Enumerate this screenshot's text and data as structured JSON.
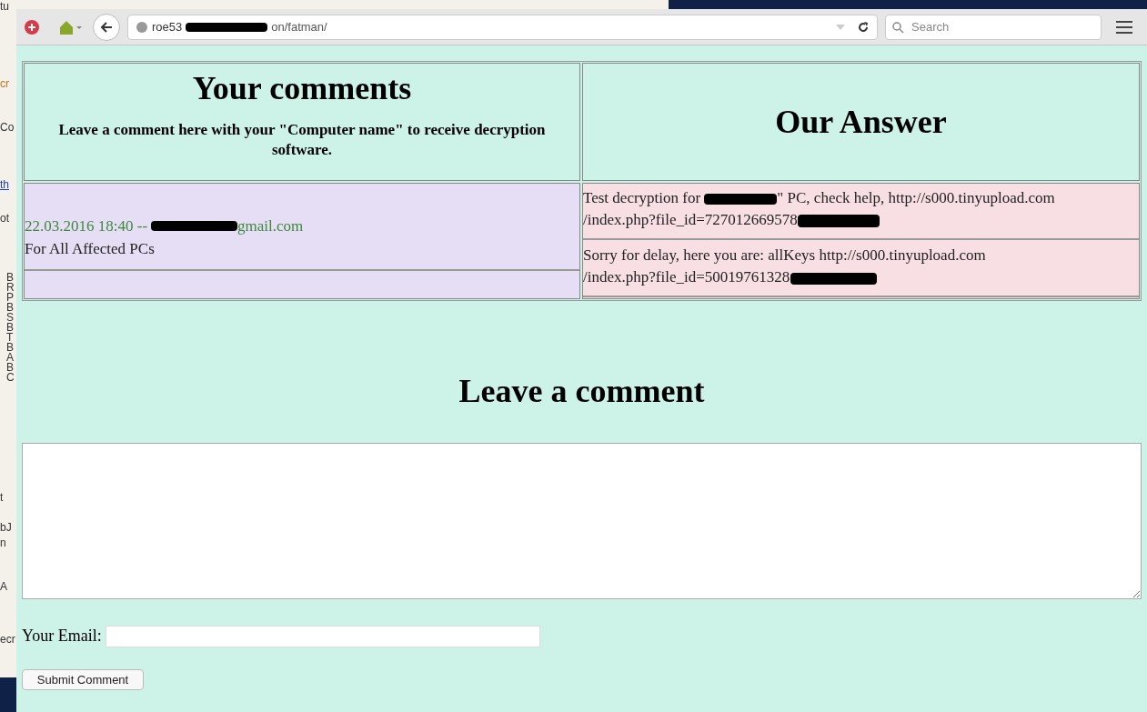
{
  "background_window": {
    "fragments": [
      "tu",
      "cr",
      "Co",
      "th",
      "ot",
      "B",
      "R",
      "P",
      "B",
      "S",
      "B",
      "T",
      "B",
      "A",
      "B",
      "C",
      "t",
      "bJ",
      "n",
      "A",
      "ecr"
    ]
  },
  "browser": {
    "url_start": "roe53",
    "url_end": "on/fatman/",
    "search": {
      "placeholder": "Search"
    }
  },
  "page": {
    "table": {
      "headers": [
        {
          "title": "Your comments",
          "subtitle": "Leave a comment here with your \"Computer name\" to receive decryption software."
        },
        {
          "title": "Our Answer"
        }
      ],
      "comments": [
        {
          "meta_start": "22.03.2016 18:40 --",
          "meta_end": "gmail.com",
          "text": "For All Affected PCs"
        }
      ],
      "answers": [
        {
          "text_start": "Test decryption for",
          "text_end": "\" PC, check help, http://s000.tinyupload.com\n/index.php?file_id=727012669578"
        },
        {
          "text_start": "Sorry for delay, here you are: allKeys http://s000.tinyupload.com\n/index.php?file_id=50019761328"
        }
      ]
    },
    "form_title": "Leave a comment",
    "email_label": "Your Email:",
    "submit": "Submit Comment"
  }
}
